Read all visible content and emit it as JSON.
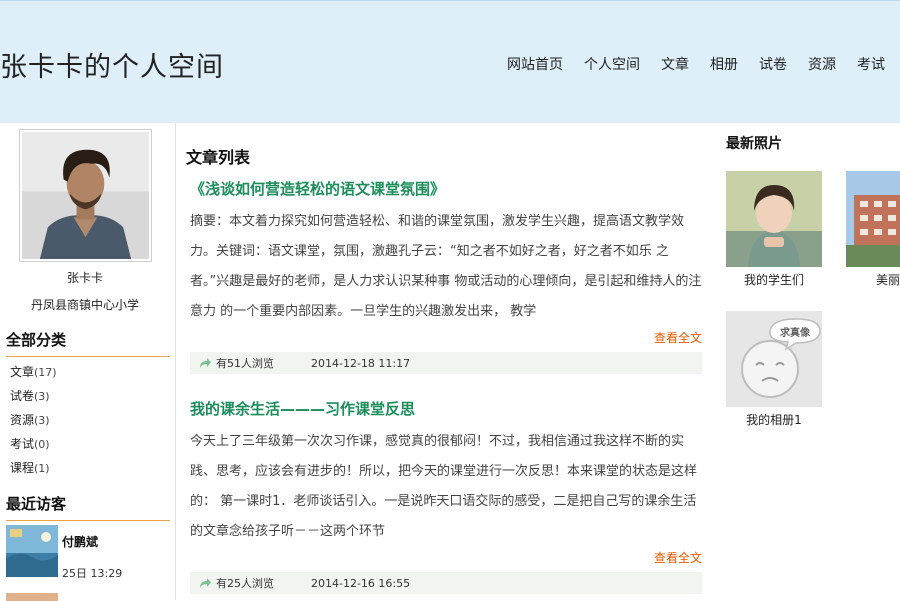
{
  "site": {
    "title": "张卡卡的个人空间"
  },
  "nav": [
    {
      "label": "网站首页"
    },
    {
      "label": "个人空间"
    },
    {
      "label": "文章"
    },
    {
      "label": "相册"
    },
    {
      "label": "试卷"
    },
    {
      "label": "资源"
    },
    {
      "label": "考试"
    }
  ],
  "profile": {
    "name": "张卡卡",
    "school": "丹凤县商镇中心小学"
  },
  "categories": {
    "heading": "全部分类",
    "items": [
      {
        "label": "文章",
        "count": "(17)"
      },
      {
        "label": "试卷",
        "count": "(3)"
      },
      {
        "label": "资源",
        "count": "(3)"
      },
      {
        "label": "考试",
        "count": "(0)"
      },
      {
        "label": "课程",
        "count": "(1)"
      }
    ]
  },
  "visitors": {
    "heading": "最近访客",
    "items": [
      {
        "name": "付鹏斌",
        "time": "25日 13:29"
      }
    ]
  },
  "articles": {
    "heading": "文章列表",
    "more_label": "查看全文",
    "items": [
      {
        "title": "《浅谈如何营造轻松的语文课堂氛围》",
        "summary": "摘要：本文着力探究如何营造轻松、和谐的课堂氛围，激发学生兴趣，提高语文教学效 力。关键词：语文课堂，氛围，激趣孔子云：“知之者不如好之者，好之者不如乐 之者。”兴趣是最好的老师，是人力求认识某种事 物或活动的心理倾向，是引起和维持人的注意力 的一个重要内部因素。一旦学生的兴趣激发出来， 教学",
        "views": "有51人浏览",
        "date": "2014-12-18 11:17"
      },
      {
        "title": "我的课余生活———习作课堂反思",
        "summary": "今天上了三年级第一次次习作课，感觉真的很郁闷！不过，我相信通过我这样不断的实践、思考，应该会有进步的！所以，把今天的课堂进行一次反思！本来课堂的状态是这样的：                          第一课时1．老师谈话引入。一是说昨天口语交际的感受，二是把自己写的课余生活的文章念给孩子听－－这两个环节",
        "views": "有25人浏览",
        "date": "2014-12-16 16:55"
      }
    ]
  },
  "photos": {
    "heading": "最新照片",
    "items": [
      {
        "caption": "我的学生们"
      },
      {
        "caption": "美丽的"
      },
      {
        "caption": "我的相册1",
        "badge": "求真像"
      }
    ]
  },
  "colors": {
    "header_bg": "#deeff9",
    "title_green": "#1c8d5b",
    "more_orange": "#e05a00",
    "divider": "#f0a040"
  }
}
